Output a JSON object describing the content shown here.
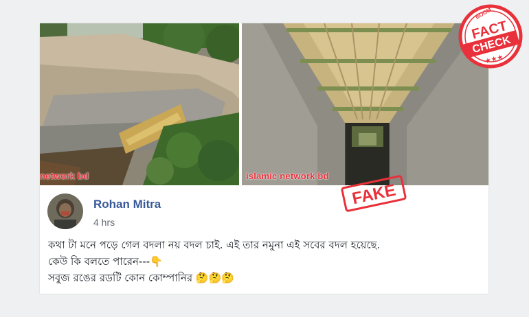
{
  "photos": {
    "left_watermark": "network bd",
    "right_watermark": "islamic network bd"
  },
  "post": {
    "author": "Rohan Mitra",
    "time": "4 hrs",
    "lines": [
      "কথা টা মনে পড়ে গেল বদলা নয় বদল চাই. এই তার নমুনা এই সবের বদল হয়েছে.",
      "কেউ কি বলতে পারেন---👇",
      "সবুজ রঙের রডটি কোন কোম্পানির 🤔🤔🤔"
    ]
  },
  "stamps": {
    "fake_label": "FAKE",
    "badge_top": "BOOM",
    "badge_line1": "FACT",
    "badge_line2": "CHECK",
    "badge_stars": "★★★"
  },
  "colors": {
    "stamp_red": "#e8313a",
    "author_blue": "#385898"
  }
}
